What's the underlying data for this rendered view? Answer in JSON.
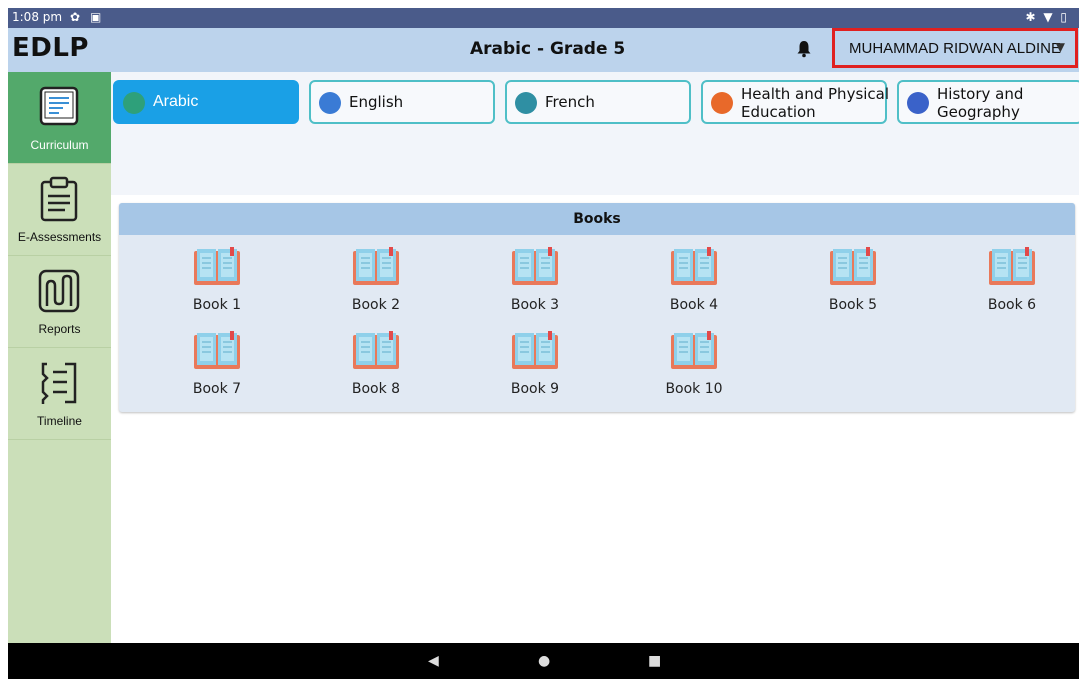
{
  "status_bar": {
    "time": "1:08 pm"
  },
  "app_bar": {
    "logo": "EDLP",
    "title": "Arabic - Grade 5",
    "user_name": "MUHAMMAD RIDWAN ALDINE"
  },
  "sidebar": {
    "items": [
      {
        "label": "Curriculum",
        "icon": "curriculum-icon",
        "active": true
      },
      {
        "label": "E-Assessments",
        "icon": "clipboard-icon",
        "active": false
      },
      {
        "label": "Reports",
        "icon": "reports-icon",
        "active": false
      },
      {
        "label": "Timeline",
        "icon": "timeline-icon",
        "active": false
      }
    ]
  },
  "subjects": [
    {
      "label": "Arabic",
      "color": "#2ea07a",
      "active": true
    },
    {
      "label": "English",
      "color": "#3a7bd5",
      "active": false
    },
    {
      "label": "French",
      "color": "#2f8fa3",
      "active": false
    },
    {
      "label": "Health and Physical Education",
      "color": "#e8692a",
      "active": false
    },
    {
      "label": "History and Geography",
      "color": "#3a62c9",
      "active": false
    }
  ],
  "books_panel": {
    "title": "Books",
    "books": [
      "Book 1",
      "Book 2",
      "Book 3",
      "Book 4",
      "Book 5",
      "Book 6",
      "Book 7",
      "Book 8",
      "Book 9",
      "Book 10"
    ]
  },
  "colors": {
    "accent": "#1aa0e6",
    "sidebar_active": "#53a96b",
    "sidebar_bg": "#cbdfb9",
    "appbar_bg": "#bcd3ec",
    "highlight_border": "#e02020"
  }
}
